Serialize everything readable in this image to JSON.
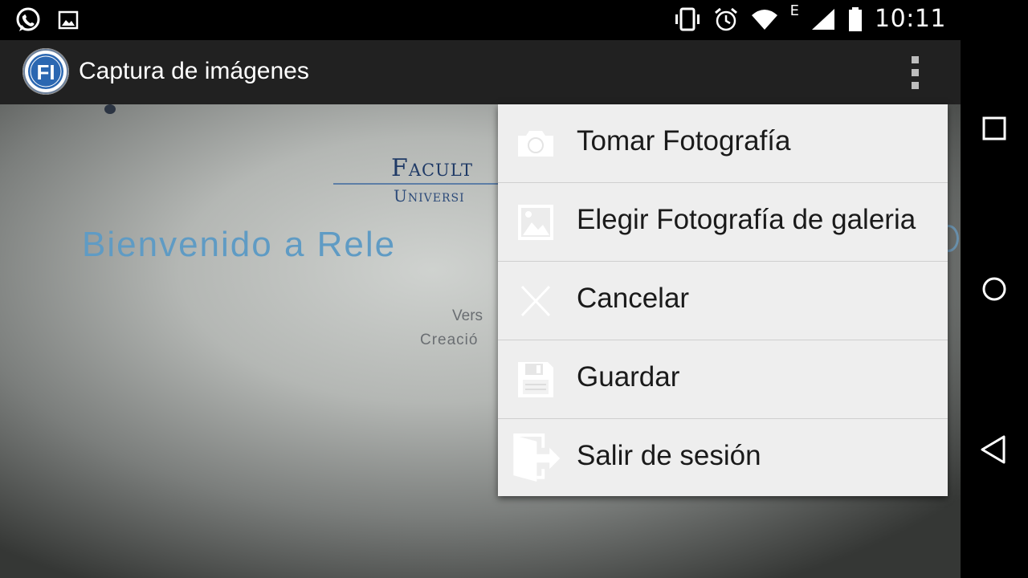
{
  "status_bar": {
    "time": "10:11",
    "network_type": "E",
    "icons": [
      "whatsapp-icon",
      "image-notification-icon",
      "vibrate-icon",
      "alarm-icon",
      "wifi-icon",
      "signal-icon",
      "battery-icon"
    ]
  },
  "action_bar": {
    "title": "Captura de imágenes",
    "logo_text": "FI",
    "overflow_icon": "overflow-menu-icon"
  },
  "background_photo": {
    "line1": "Facult",
    "line2": "Universi",
    "line3": "Bienvenido a Rele",
    "line4": "Vers",
    "line5": "Creació"
  },
  "menu": {
    "items": [
      {
        "label": "Tomar Fotografía",
        "icon": "camera-icon"
      },
      {
        "label": "Elegir Fotografía de galeria",
        "icon": "gallery-icon"
      },
      {
        "label": "Cancelar",
        "icon": "close-icon"
      },
      {
        "label": "Guardar",
        "icon": "save-icon"
      },
      {
        "label": "Salir de sesión",
        "icon": "logout-icon"
      }
    ]
  },
  "nav_bar": {
    "buttons": [
      "recents-icon",
      "home-icon",
      "back-icon"
    ]
  },
  "colors": {
    "action_bar_bg": "#212121",
    "menu_bg": "#eeeeee",
    "menu_icon": "#ffffff",
    "status_bar_bg": "#000000"
  }
}
